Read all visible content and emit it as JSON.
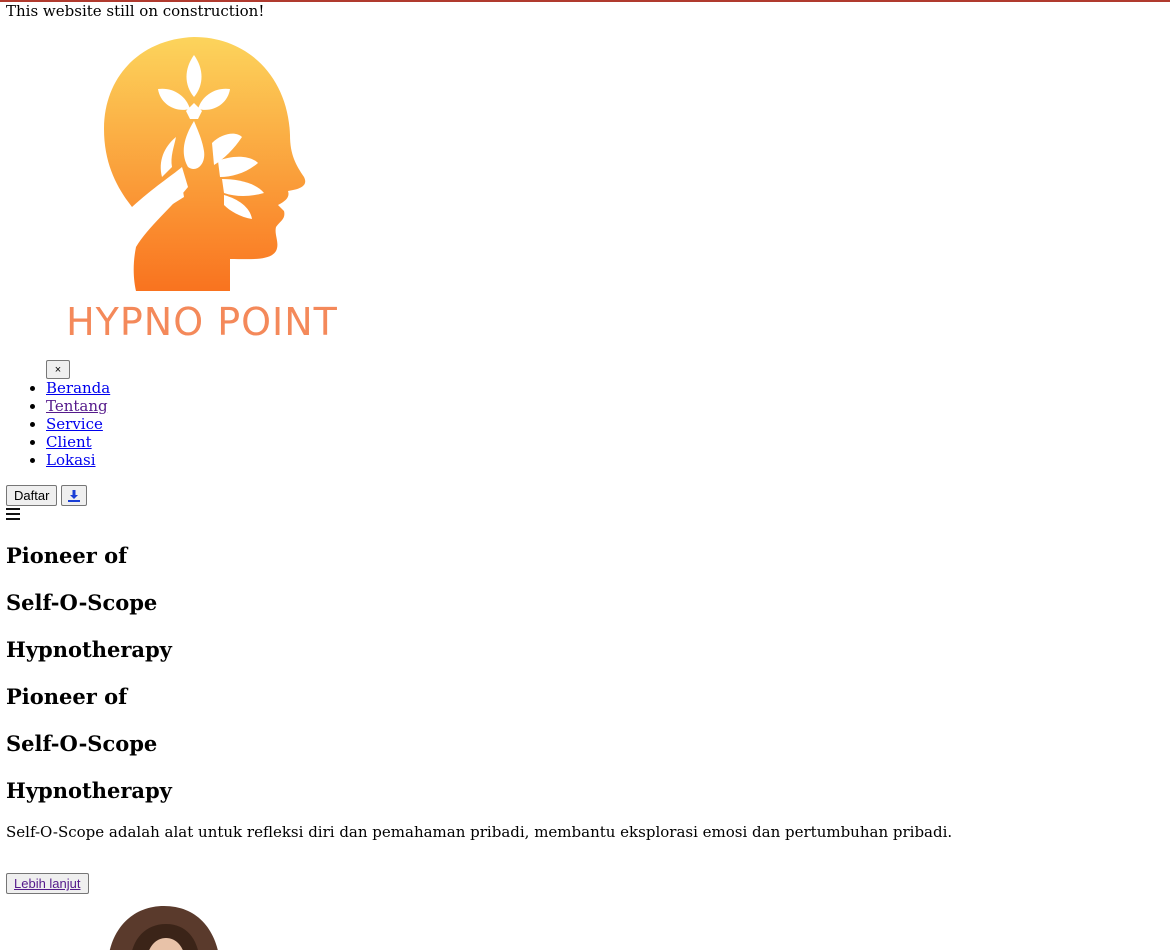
{
  "notice": "This website still on construction!",
  "logo": {
    "brand_text": "HYPNO POINT",
    "colors": {
      "top": "#fbd15a",
      "bottom": "#f97a22",
      "text": "#f4895a"
    }
  },
  "nav": {
    "close_label": "×",
    "items": [
      {
        "label": "Beranda",
        "visited": false
      },
      {
        "label": "Tentang",
        "visited": true
      },
      {
        "label": "Service",
        "visited": false
      },
      {
        "label": "Client",
        "visited": false
      },
      {
        "label": "Lokasi",
        "visited": false
      }
    ]
  },
  "actions": {
    "register_label": "Daftar",
    "download_icon": "download-icon"
  },
  "menu_icon": "hamburger-icon",
  "hero": {
    "line1": "Pioneer of",
    "line2": "Self-O-Scope",
    "line3": "Hypnotherapy",
    "description": "Self-O-Scope adalah alat untuk refleksi diri dan pemahaman pribadi, membantu eksplorasi emosi dan pertumbuhan pribadi.",
    "more_label": "Lebih lanjut"
  },
  "accent_color": "#b03a2e"
}
